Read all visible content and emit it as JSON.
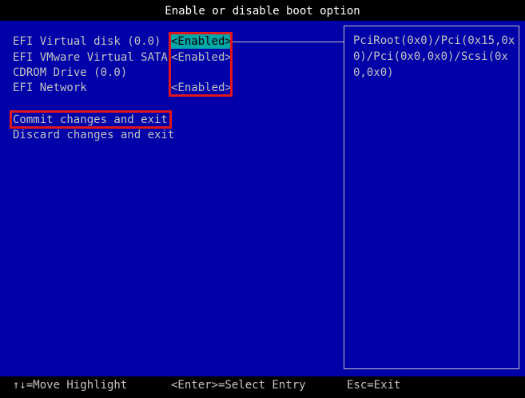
{
  "title": "Enable or disable boot option",
  "boot_options": [
    {
      "label": "EFI Virtual disk (0.0)",
      "value": "<Enabled>"
    },
    {
      "label": "EFI VMware Virtual SATA",
      "value": "<Enabled>"
    },
    {
      "label": "CDROM Drive (0.0)",
      "value": ""
    },
    {
      "label": "EFI Network",
      "value": "<Enabled>"
    }
  ],
  "actions": {
    "commit": "Commit changes and exit",
    "discard": "Discard changes and exit"
  },
  "help_text": "PciRoot(0x0)/Pci(0x15,0x0)/Pci(0x0,0x0)/Scsi(0x0,0x0)",
  "footer": {
    "move": "↑↓=Move Highlight",
    "select": "<Enter>=Select Entry",
    "exit": "Esc=Exit"
  },
  "colors": {
    "background": "#0000a8",
    "text": "#c4c4c4",
    "highlight": "#00a8a8",
    "annotation": "#e0161c"
  }
}
